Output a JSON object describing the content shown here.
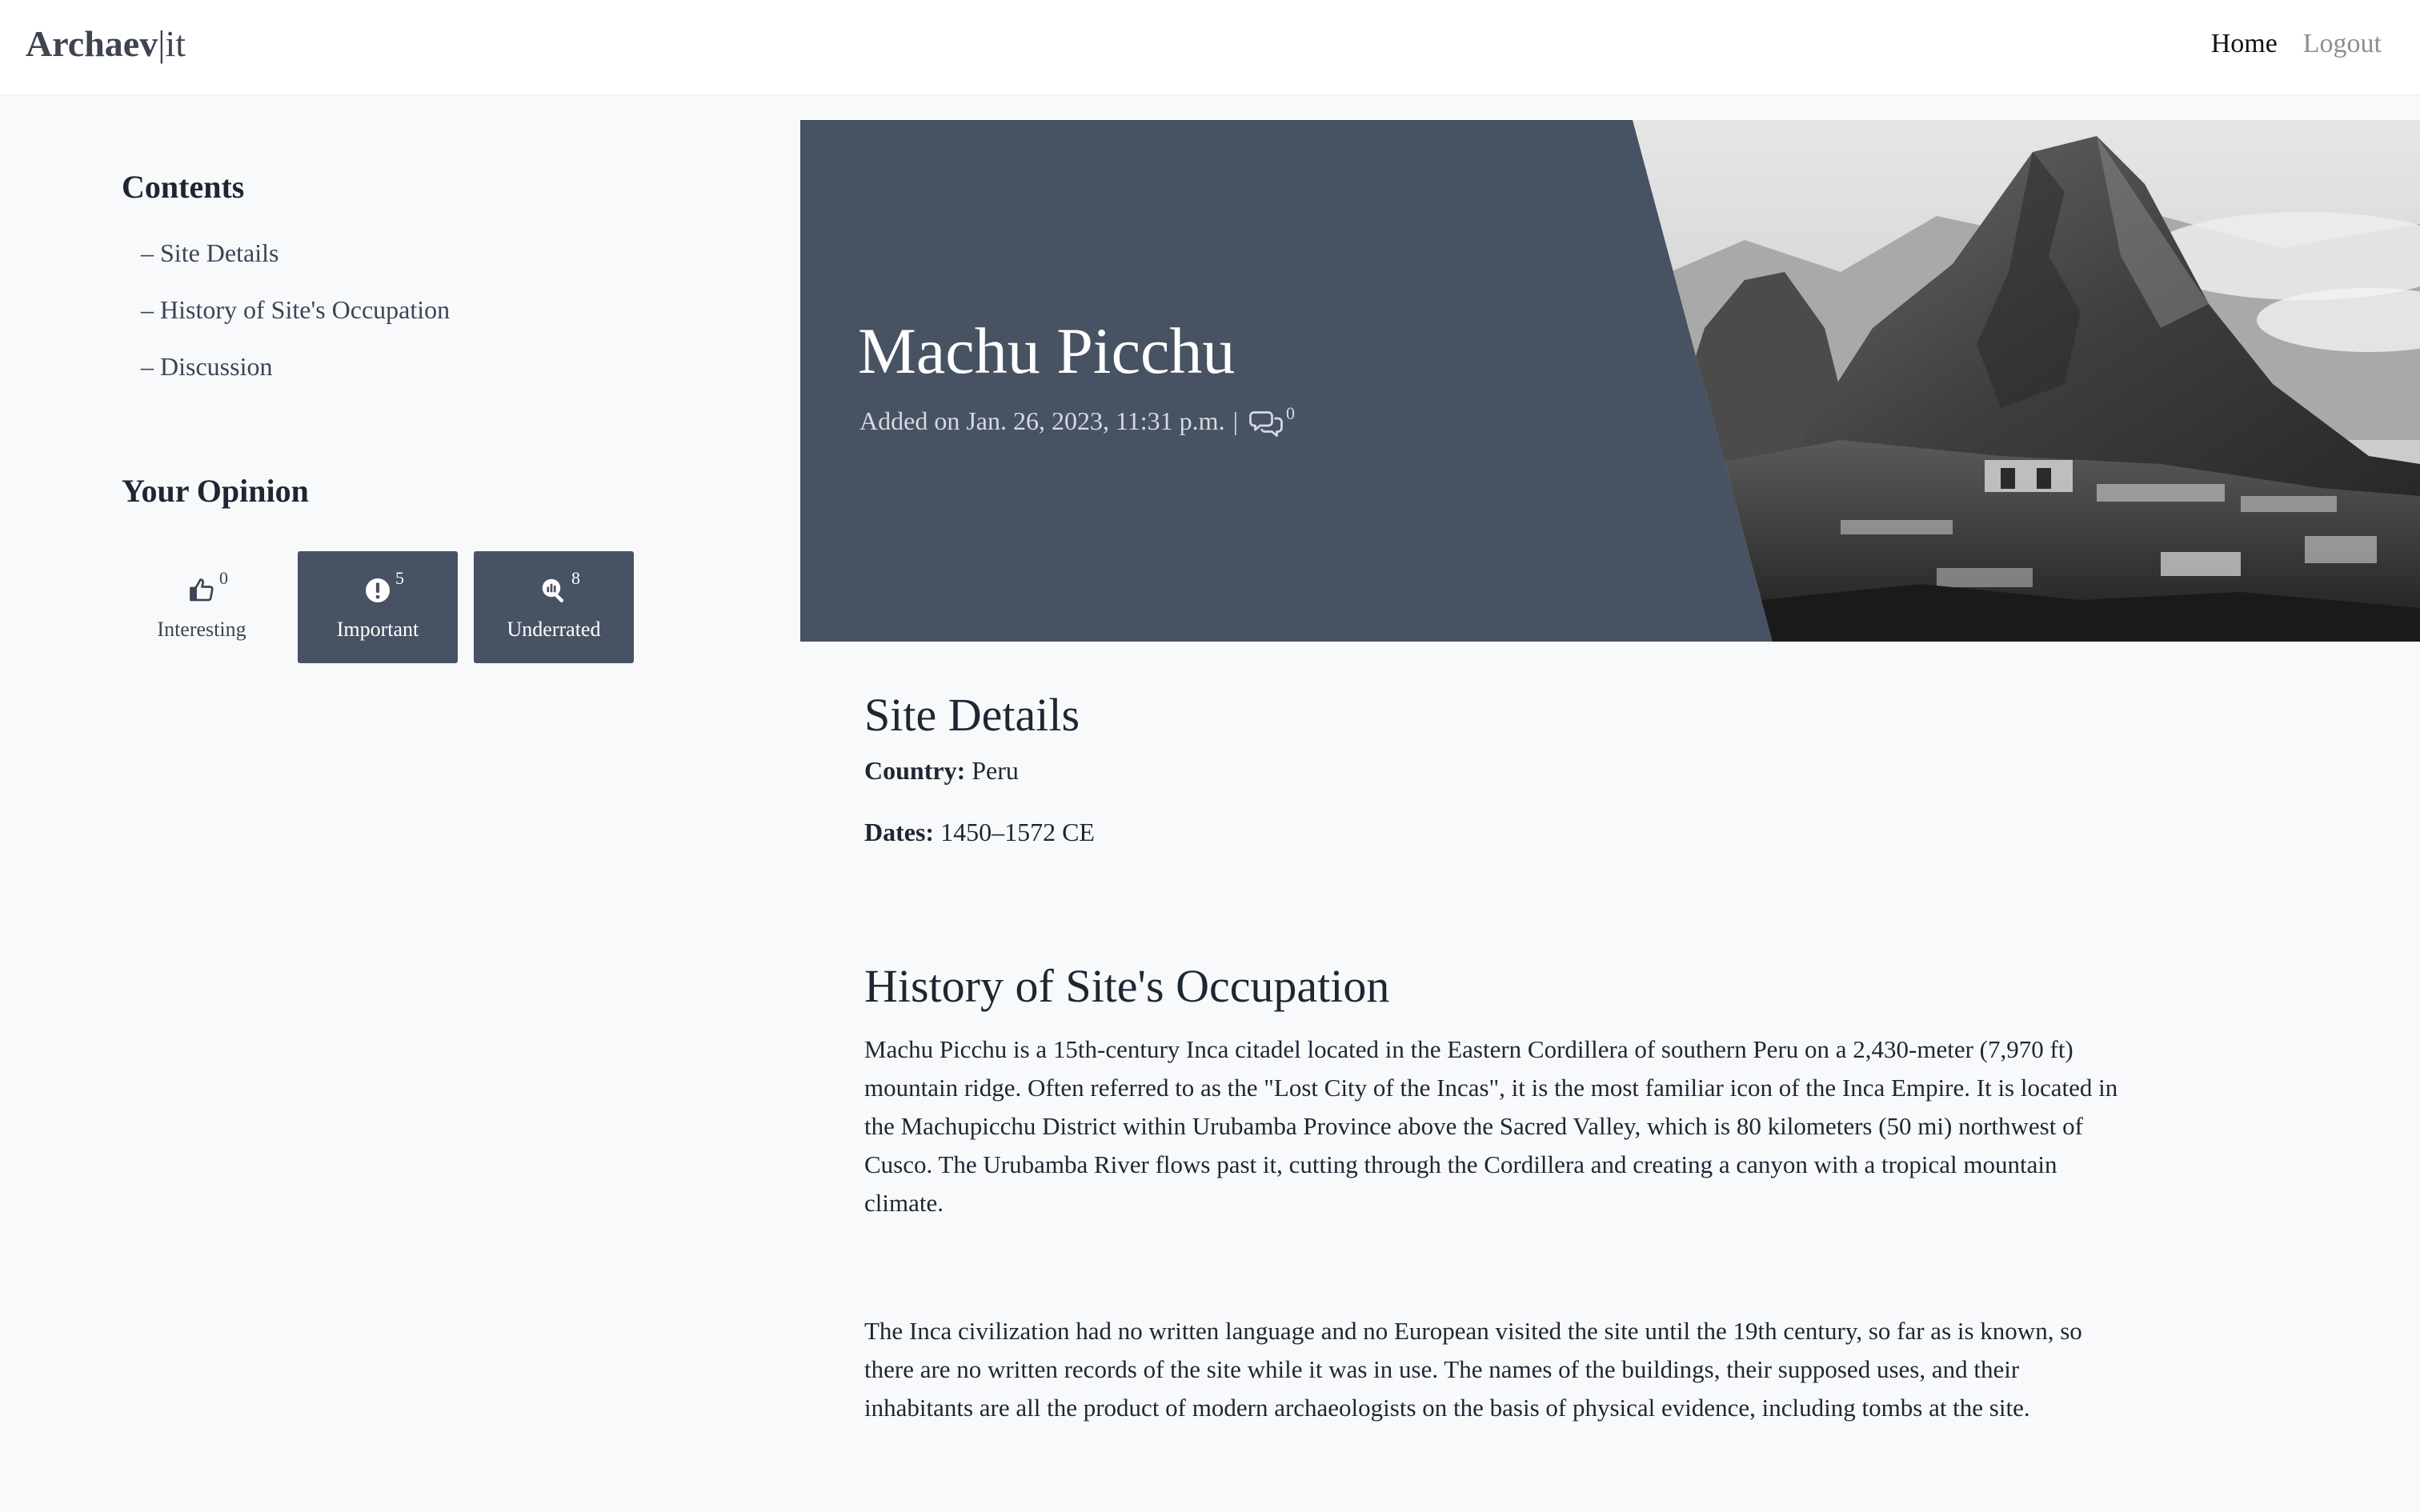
{
  "navbar": {
    "brand_bold": "Archaev",
    "brand_separator": "|",
    "brand_rest": "it",
    "links": [
      {
        "label": "Home",
        "active": true
      },
      {
        "label": "Logout",
        "active": false
      }
    ]
  },
  "sidebar": {
    "contents_heading": "Contents",
    "toc": [
      "– Site Details",
      "– History of Site's Occupation",
      "– Discussion"
    ],
    "opinion_heading": "Your Opinion",
    "opinions": [
      {
        "label": "Interesting",
        "count": "0",
        "icon": "thumbs-up-icon",
        "selected": false
      },
      {
        "label": "Important",
        "count": "5",
        "icon": "exclamation-circle-icon",
        "selected": true
      },
      {
        "label": "Underrated",
        "count": "8",
        "icon": "search-chart-icon",
        "selected": true
      }
    ]
  },
  "hero": {
    "title": "Machu Picchu",
    "added_on": "Added on Jan. 26, 2023, 11:31 p.m.",
    "separator": "|",
    "comment_count": "0",
    "background_color": "#475263"
  },
  "site_details": {
    "heading": "Site Details",
    "country_label": "Country:",
    "country_value": "Peru",
    "dates_label": "Dates:",
    "dates_value": "1450–1572 CE"
  },
  "history": {
    "heading": "History of Site's Occupation",
    "paragraphs": [
      "Machu Picchu is a 15th-century Inca citadel located in the Eastern Cordillera of southern Peru on a 2,430-meter (7,970 ft) mountain ridge. Often referred to as the \"Lost City of the Incas\", it is the most familiar icon of the Inca Empire. It is located in the Machupicchu District within Urubamba Province above the Sacred Valley, which is 80 kilometers (50 mi) northwest of Cusco. The Urubamba River flows past it, cutting through the Cordillera and creating a canyon with a tropical mountain climate.",
      "The Inca civilization had no written language and no European visited the site until the 19th century, so far as is known, so there are no written records of the site while it was in use. The names of the buildings, their supposed uses, and their inhabitants are all the product of modern archaeologists on the basis of physical evidence, including tombs at the site."
    ]
  }
}
